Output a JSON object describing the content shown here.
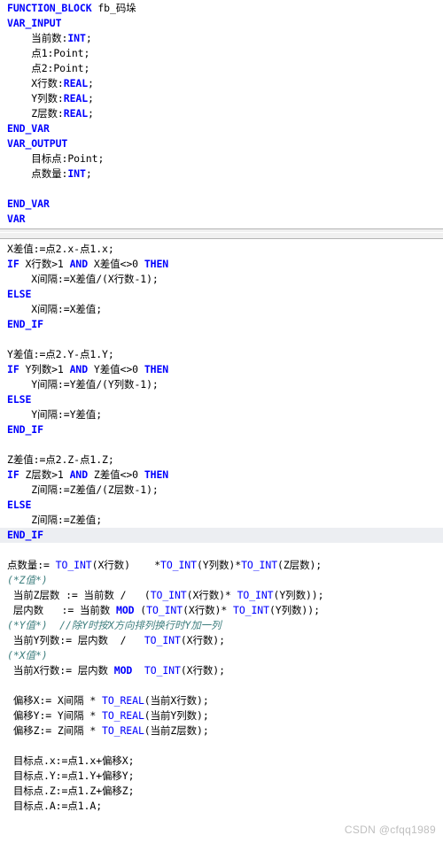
{
  "editor": {
    "language": "Structured Text",
    "colors": {
      "keyword": "#0000FF",
      "comment": "#3F7F7F",
      "text": "#000000",
      "background": "#FFFFFF",
      "selection": "#ECEEF2",
      "splitter": "#F0F0F0"
    }
  },
  "declaration": {
    "lines": [
      {
        "id": "decl-0",
        "indent": 0,
        "segments": [
          {
            "t": "FUNCTION_BLOCK",
            "c": "kw"
          },
          {
            "t": " fb_码垛",
            "c": ""
          }
        ]
      },
      {
        "id": "decl-1",
        "indent": 0,
        "segments": [
          {
            "t": "VAR_INPUT",
            "c": "kw"
          }
        ]
      },
      {
        "id": "decl-2",
        "indent": 1,
        "segments": [
          {
            "t": "当前数:",
            "c": ""
          },
          {
            "t": "INT",
            "c": "kw"
          },
          {
            "t": ";",
            "c": ""
          }
        ]
      },
      {
        "id": "decl-3",
        "indent": 1,
        "segments": [
          {
            "t": "点1:Point;",
            "c": ""
          }
        ]
      },
      {
        "id": "decl-4",
        "indent": 1,
        "segments": [
          {
            "t": "点2:Point;",
            "c": ""
          }
        ]
      },
      {
        "id": "decl-5",
        "indent": 1,
        "segments": [
          {
            "t": "X行数:",
            "c": ""
          },
          {
            "t": "REAL",
            "c": "kw"
          },
          {
            "t": ";",
            "c": ""
          }
        ]
      },
      {
        "id": "decl-6",
        "indent": 1,
        "segments": [
          {
            "t": "Y列数:",
            "c": ""
          },
          {
            "t": "REAL",
            "c": "kw"
          },
          {
            "t": ";",
            "c": ""
          }
        ]
      },
      {
        "id": "decl-7",
        "indent": 1,
        "segments": [
          {
            "t": "Z层数:",
            "c": ""
          },
          {
            "t": "REAL",
            "c": "kw"
          },
          {
            "t": ";",
            "c": ""
          }
        ]
      },
      {
        "id": "decl-8",
        "indent": 0,
        "segments": [
          {
            "t": "END_VAR",
            "c": "kw"
          }
        ]
      },
      {
        "id": "decl-9",
        "indent": 0,
        "segments": [
          {
            "t": "VAR_OUTPUT",
            "c": "kw"
          }
        ]
      },
      {
        "id": "decl-10",
        "indent": 1,
        "segments": [
          {
            "t": "目标点:Point;",
            "c": ""
          }
        ]
      },
      {
        "id": "decl-11",
        "indent": 1,
        "segments": [
          {
            "t": "点数量:",
            "c": ""
          },
          {
            "t": "INT",
            "c": "kw"
          },
          {
            "t": ";",
            "c": ""
          }
        ]
      },
      {
        "id": "decl-12",
        "indent": 0,
        "segments": [
          {
            "t": "",
            "c": ""
          }
        ]
      },
      {
        "id": "decl-13",
        "indent": 0,
        "segments": [
          {
            "t": "END_VAR",
            "c": "kw"
          }
        ]
      },
      {
        "id": "decl-14",
        "indent": 0,
        "segments": [
          {
            "t": "VAR",
            "c": "kw"
          }
        ]
      }
    ]
  },
  "implementation": {
    "lines": [
      {
        "id": "impl-0",
        "indent": 0,
        "selected": false,
        "segments": [
          {
            "t": "X差值:=点2.x-点1.x;",
            "c": ""
          }
        ]
      },
      {
        "id": "impl-1",
        "indent": 0,
        "selected": false,
        "segments": [
          {
            "t": "IF",
            "c": "kw"
          },
          {
            "t": " X行数>1 ",
            "c": ""
          },
          {
            "t": "AND",
            "c": "kw"
          },
          {
            "t": " X差值<>0 ",
            "c": ""
          },
          {
            "t": "THEN",
            "c": "kw"
          }
        ]
      },
      {
        "id": "impl-2",
        "indent": 1,
        "selected": false,
        "segments": [
          {
            "t": "X间隔:=X差值/(X行数-1);",
            "c": ""
          }
        ]
      },
      {
        "id": "impl-3",
        "indent": 0,
        "selected": false,
        "segments": [
          {
            "t": "ELSE",
            "c": "kw"
          }
        ]
      },
      {
        "id": "impl-4",
        "indent": 1,
        "selected": false,
        "segments": [
          {
            "t": "X间隔:=X差值;",
            "c": ""
          }
        ]
      },
      {
        "id": "impl-5",
        "indent": 0,
        "selected": false,
        "segments": [
          {
            "t": "END_IF",
            "c": "kw"
          }
        ]
      },
      {
        "id": "impl-6",
        "indent": 0,
        "selected": false,
        "segments": [
          {
            "t": "",
            "c": ""
          }
        ]
      },
      {
        "id": "impl-7",
        "indent": 0,
        "selected": false,
        "segments": [
          {
            "t": "Y差值:=点2.Y-点1.Y;",
            "c": ""
          }
        ]
      },
      {
        "id": "impl-8",
        "indent": 0,
        "selected": false,
        "segments": [
          {
            "t": "IF",
            "c": "kw"
          },
          {
            "t": " Y列数>1 ",
            "c": ""
          },
          {
            "t": "AND",
            "c": "kw"
          },
          {
            "t": " Y差值<>0 ",
            "c": ""
          },
          {
            "t": "THEN",
            "c": "kw"
          }
        ]
      },
      {
        "id": "impl-9",
        "indent": 1,
        "selected": false,
        "segments": [
          {
            "t": "Y间隔:=Y差值/(Y列数-1);",
            "c": ""
          }
        ]
      },
      {
        "id": "impl-10",
        "indent": 0,
        "selected": false,
        "segments": [
          {
            "t": "ELSE",
            "c": "kw"
          }
        ]
      },
      {
        "id": "impl-11",
        "indent": 1,
        "selected": false,
        "segments": [
          {
            "t": "Y间隔:=Y差值;",
            "c": ""
          }
        ]
      },
      {
        "id": "impl-12",
        "indent": 0,
        "selected": false,
        "segments": [
          {
            "t": "END_IF",
            "c": "kw"
          }
        ]
      },
      {
        "id": "impl-13",
        "indent": 0,
        "selected": false,
        "segments": [
          {
            "t": "",
            "c": ""
          }
        ]
      },
      {
        "id": "impl-14",
        "indent": 0,
        "selected": false,
        "segments": [
          {
            "t": "Z差值:=点2.Z-点1.Z;",
            "c": ""
          }
        ]
      },
      {
        "id": "impl-15",
        "indent": 0,
        "selected": false,
        "segments": [
          {
            "t": "IF",
            "c": "kw"
          },
          {
            "t": " Z层数>1 ",
            "c": ""
          },
          {
            "t": "AND",
            "c": "kw"
          },
          {
            "t": " Z差值<>0 ",
            "c": ""
          },
          {
            "t": "THEN",
            "c": "kw"
          }
        ]
      },
      {
        "id": "impl-16",
        "indent": 1,
        "selected": false,
        "segments": [
          {
            "t": "Z间隔:=Z差值/(Z层数-1);",
            "c": ""
          }
        ]
      },
      {
        "id": "impl-17",
        "indent": 0,
        "selected": false,
        "segments": [
          {
            "t": "ELSE",
            "c": "kw"
          }
        ]
      },
      {
        "id": "impl-18",
        "indent": 1,
        "selected": false,
        "segments": [
          {
            "t": "Z间隔:=Z差值;",
            "c": ""
          }
        ]
      },
      {
        "id": "impl-19",
        "indent": 0,
        "selected": true,
        "segments": [
          {
            "t": "END_IF",
            "c": "kw"
          }
        ]
      },
      {
        "id": "impl-20",
        "indent": 0,
        "selected": false,
        "segments": [
          {
            "t": "",
            "c": ""
          }
        ]
      },
      {
        "id": "impl-21",
        "indent": 0,
        "selected": false,
        "segments": [
          {
            "t": "点数量:= ",
            "c": ""
          },
          {
            "t": "TO_INT",
            "c": "fn"
          },
          {
            "t": "(X行数)    *",
            "c": ""
          },
          {
            "t": "TO_INT",
            "c": "fn"
          },
          {
            "t": "(Y列数)*",
            "c": ""
          },
          {
            "t": "TO_INT",
            "c": "fn"
          },
          {
            "t": "(Z层数);",
            "c": ""
          }
        ]
      },
      {
        "id": "impl-22",
        "indent": 0,
        "selected": false,
        "segments": [
          {
            "t": "(*Z值*)",
            "c": "cmt"
          }
        ]
      },
      {
        "id": "impl-23",
        "indent": 0,
        "selected": false,
        "segments": [
          {
            "t": " 当前Z层数 := 当前数 /   (",
            "c": ""
          },
          {
            "t": "TO_INT",
            "c": "fn"
          },
          {
            "t": "(X行数)* ",
            "c": ""
          },
          {
            "t": "TO_INT",
            "c": "fn"
          },
          {
            "t": "(Y列数));",
            "c": ""
          }
        ]
      },
      {
        "id": "impl-24",
        "indent": 0,
        "selected": false,
        "segments": [
          {
            "t": " 层内数   := 当前数 ",
            "c": ""
          },
          {
            "t": "MOD",
            "c": "kw"
          },
          {
            "t": " (",
            "c": ""
          },
          {
            "t": "TO_INT",
            "c": "fn"
          },
          {
            "t": "(X行数)* ",
            "c": ""
          },
          {
            "t": "TO_INT",
            "c": "fn"
          },
          {
            "t": "(Y列数));",
            "c": ""
          }
        ]
      },
      {
        "id": "impl-25",
        "indent": 0,
        "selected": false,
        "segments": [
          {
            "t": "(*Y值*)  //除Y时按X方向排列换行时Y加一列",
            "c": "cmt"
          }
        ]
      },
      {
        "id": "impl-26",
        "indent": 0,
        "selected": false,
        "segments": [
          {
            "t": " 当前Y列数:= 层内数  /   ",
            "c": ""
          },
          {
            "t": "TO_INT",
            "c": "fn"
          },
          {
            "t": "(X行数);",
            "c": ""
          }
        ]
      },
      {
        "id": "impl-27",
        "indent": 0,
        "selected": false,
        "segments": [
          {
            "t": "(*X值*)",
            "c": "cmt"
          }
        ]
      },
      {
        "id": "impl-28",
        "indent": 0,
        "selected": false,
        "segments": [
          {
            "t": " 当前X行数:= 层内数 ",
            "c": ""
          },
          {
            "t": "MOD",
            "c": "kw"
          },
          {
            "t": "  ",
            "c": ""
          },
          {
            "t": "TO_INT",
            "c": "fn"
          },
          {
            "t": "(X行数);",
            "c": ""
          }
        ]
      },
      {
        "id": "impl-29",
        "indent": 0,
        "selected": false,
        "segments": [
          {
            "t": "",
            "c": ""
          }
        ]
      },
      {
        "id": "impl-30",
        "indent": 0,
        "selected": false,
        "segments": [
          {
            "t": " 偏移X:= X间隔 * ",
            "c": ""
          },
          {
            "t": "TO_REAL",
            "c": "fn"
          },
          {
            "t": "(当前X行数);",
            "c": ""
          }
        ]
      },
      {
        "id": "impl-31",
        "indent": 0,
        "selected": false,
        "segments": [
          {
            "t": " 偏移Y:= Y间隔 * ",
            "c": ""
          },
          {
            "t": "TO_REAL",
            "c": "fn"
          },
          {
            "t": "(当前Y列数);",
            "c": ""
          }
        ]
      },
      {
        "id": "impl-32",
        "indent": 0,
        "selected": false,
        "segments": [
          {
            "t": " 偏移Z:= Z间隔 * ",
            "c": ""
          },
          {
            "t": "TO_REAL",
            "c": "fn"
          },
          {
            "t": "(当前Z层数);",
            "c": ""
          }
        ]
      },
      {
        "id": "impl-33",
        "indent": 0,
        "selected": false,
        "segments": [
          {
            "t": "",
            "c": ""
          }
        ]
      },
      {
        "id": "impl-34",
        "indent": 0,
        "selected": false,
        "segments": [
          {
            "t": " 目标点.x:=点1.x+偏移X;",
            "c": ""
          }
        ]
      },
      {
        "id": "impl-35",
        "indent": 0,
        "selected": false,
        "segments": [
          {
            "t": " 目标点.Y:=点1.Y+偏移Y;",
            "c": ""
          }
        ]
      },
      {
        "id": "impl-36",
        "indent": 0,
        "selected": false,
        "segments": [
          {
            "t": " 目标点.Z:=点1.Z+偏移Z;",
            "c": ""
          }
        ]
      },
      {
        "id": "impl-37",
        "indent": 0,
        "selected": false,
        "segments": [
          {
            "t": " 目标点.A:=点1.A;",
            "c": ""
          }
        ]
      }
    ]
  },
  "watermark": {
    "text": "CSDN @cfqq1989"
  }
}
